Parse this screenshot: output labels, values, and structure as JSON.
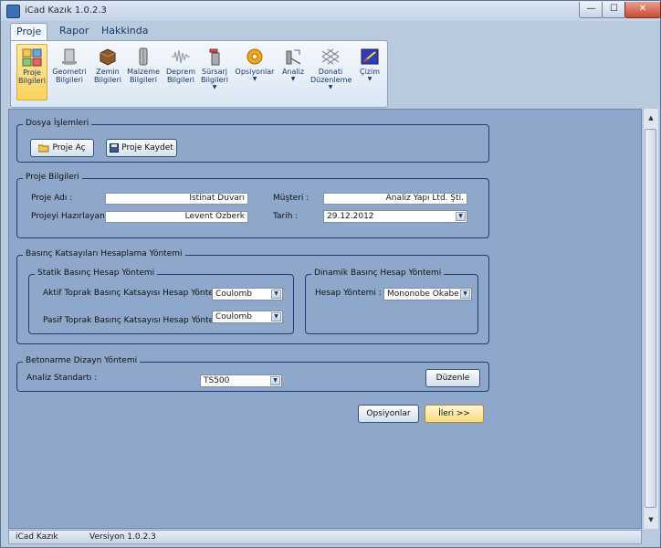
{
  "window": {
    "title": "iCad Kazık 1.0.2.3",
    "min": "—",
    "max": "☐",
    "close": "✕"
  },
  "ribbon": {
    "tabs": [
      "Proje",
      "Rapor",
      "Hakkinda"
    ],
    "buttons": [
      {
        "line1": "Proje",
        "line2": "Bilgileri"
      },
      {
        "line1": "Geometri",
        "line2": "Bilgileri"
      },
      {
        "line1": "Zemin",
        "line2": "Bilgileri"
      },
      {
        "line1": "Malzeme",
        "line2": "Bilgileri"
      },
      {
        "line1": "Deprem",
        "line2": "Bilgileri"
      },
      {
        "line1": "Sürsarj",
        "line2": "Bilgileri"
      },
      {
        "line1": "Opsiyonlar",
        "line2": ""
      },
      {
        "line1": "Analiz",
        "line2": ""
      },
      {
        "line1": "Donati",
        "line2": "Düzenleme"
      },
      {
        "line1": "Çizim",
        "line2": ""
      }
    ]
  },
  "dosya": {
    "legend": "Dosya İşlemleri",
    "open_label": "Proje Aç",
    "save_label": "Proje Kaydet"
  },
  "proje": {
    "legend": "Proje Bilgileri",
    "name_label": "Proje Adı :",
    "name_value": "İstinat Duvarı",
    "author_label": "Projeyi Hazırlayan :",
    "author_value": "Levent Özberk",
    "client_label": "Müşteri :",
    "client_value": "Analiz Yapı Ltd. Şti.",
    "date_label": "Tarih :",
    "date_value": "29.12.2012"
  },
  "basinc": {
    "legend": "Basınç Katsayıları Hesaplama Yöntemi",
    "statik": {
      "legend": "Statik Basınç Hesap Yöntemi",
      "active_label": "Aktif Toprak Basınç Katsayısı Hesap Yöntemi :",
      "active_value": "Coulomb",
      "passive_label": "Pasif Toprak Basınç Katsayısı Hesap Yöntemi :",
      "passive_value": "Coulomb"
    },
    "dinamik": {
      "legend": "Dinamik Basınç Hesap Yöntemi",
      "method_label": "Hesap Yöntemi :",
      "method_value": "Mononobe Okabe"
    }
  },
  "betonarme": {
    "legend": "Betonarme Dizayn Yöntemi",
    "standard_label": "Analiz Standartı :",
    "standard_value": "TS500",
    "edit_label": "Düzenle"
  },
  "actions": {
    "options_label": "Opsiyonlar",
    "next_label": "İleri >>"
  },
  "status": {
    "app": "iCad Kazık",
    "version": "Versiyon 1.0.2.3"
  }
}
